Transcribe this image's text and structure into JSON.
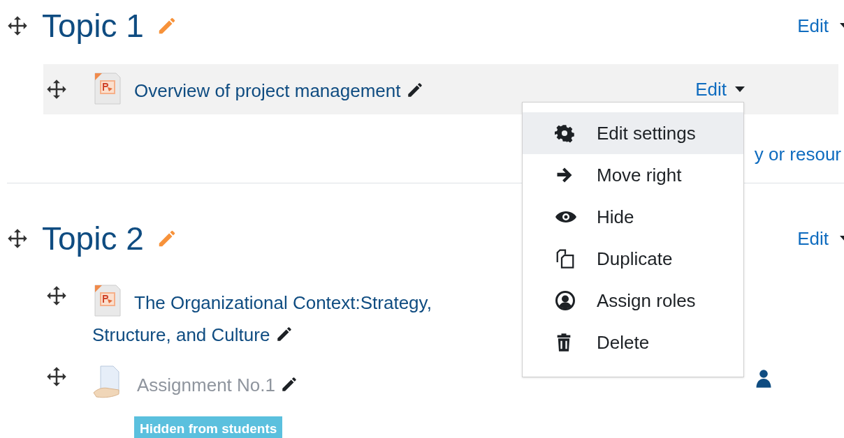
{
  "sections": [
    {
      "title": "Topic 1",
      "edit_label": "Edit",
      "add_text": "y or resour",
      "items": [
        {
          "kind": "file",
          "title": "Overview of project management",
          "edit_label": "Edit",
          "highlighted": true,
          "hidden": false
        }
      ]
    },
    {
      "title": "Topic 2",
      "edit_label": "Edit",
      "items": [
        {
          "kind": "file",
          "title": "The Organizational Context:Strategy, Structure, and Culture",
          "highlighted": false,
          "hidden": false
        },
        {
          "kind": "assignment",
          "title": "Assignment No.1",
          "highlighted": false,
          "hidden": true,
          "badge": "Hidden from students"
        }
      ]
    }
  ],
  "menu": {
    "items": [
      {
        "label": "Edit settings",
        "selected": true
      },
      {
        "label": "Move right",
        "selected": false
      },
      {
        "label": "Hide",
        "selected": false
      },
      {
        "label": "Duplicate",
        "selected": false
      },
      {
        "label": "Assign roles",
        "selected": false
      },
      {
        "label": "Delete",
        "selected": false
      }
    ]
  }
}
